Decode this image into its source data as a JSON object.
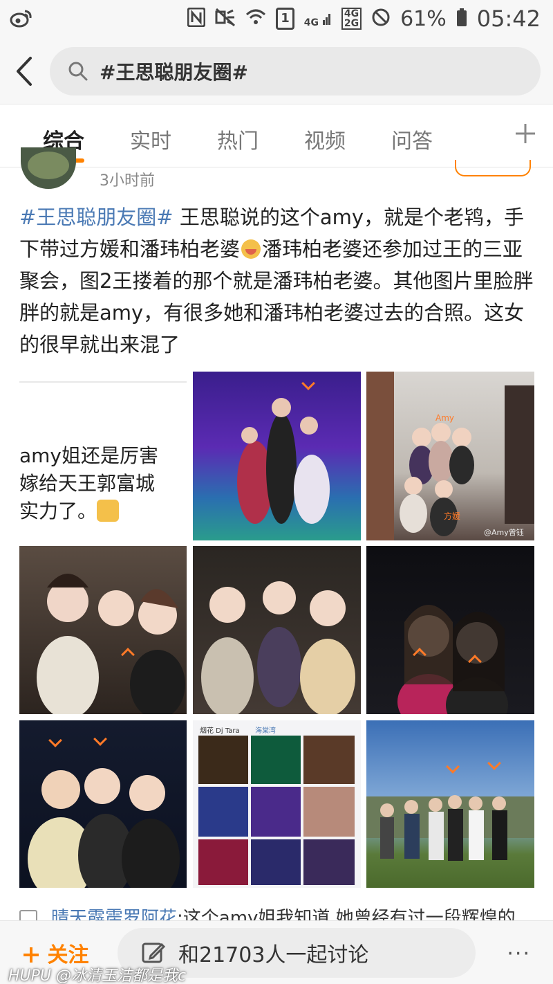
{
  "status_bar": {
    "app_icon": "weibo-icon",
    "network_4g": "4G",
    "network_4g2g_top": "4G",
    "network_4g2g_bottom": "2G",
    "sim_badge": "1",
    "battery_percent": "61%",
    "time": "05:42"
  },
  "search": {
    "query": "#王思聪朋友圈#"
  },
  "tabs": [
    {
      "label": "综合",
      "active": true
    },
    {
      "label": "实时",
      "active": false
    },
    {
      "label": "热门",
      "active": false
    },
    {
      "label": "视频",
      "active": false
    },
    {
      "label": "问答",
      "active": false
    }
  ],
  "post": {
    "time": "3小时前",
    "hashtag": "#王思聪朋友圈#",
    "text_1": " 王思聪说的这个amy，就是个老鸨，手下带过方媛和潘玮柏老婆",
    "text_2": "潘玮柏老婆还参加过王的三亚聚会，图2王搂着的那个就是潘玮柏老婆。其他图片里脸胖胖的就是amy，有很多她和潘玮柏老婆过去的合照。这女的很早就出来混了",
    "image_caption_1": "amy姐还是厉害",
    "image_caption_2": "嫁给天王郭富城",
    "image_caption_3": "实力了。",
    "photo2_label_amy": "Amy",
    "photo2_label_fangyuan": "方媛",
    "photo2_watermark": "@Amy曾钰",
    "photo8_header": "烟花 Dj Tara",
    "photo8_location": "海棠湾"
  },
  "next_comment": {
    "author": "晴天霹雳罗阿花",
    "text": ":这个amy姐我知道,她曾经有过一段辉煌的"
  },
  "bottom_bar": {
    "follow_label": "关注",
    "discuss_label": "和21703人一起讨论",
    "more_label": "···"
  },
  "watermark": "HUPU @冰清玉洁都是我c",
  "colors": {
    "accent": "#ff8200",
    "link": "#4a79b4",
    "arrow": "#ff7a28"
  }
}
